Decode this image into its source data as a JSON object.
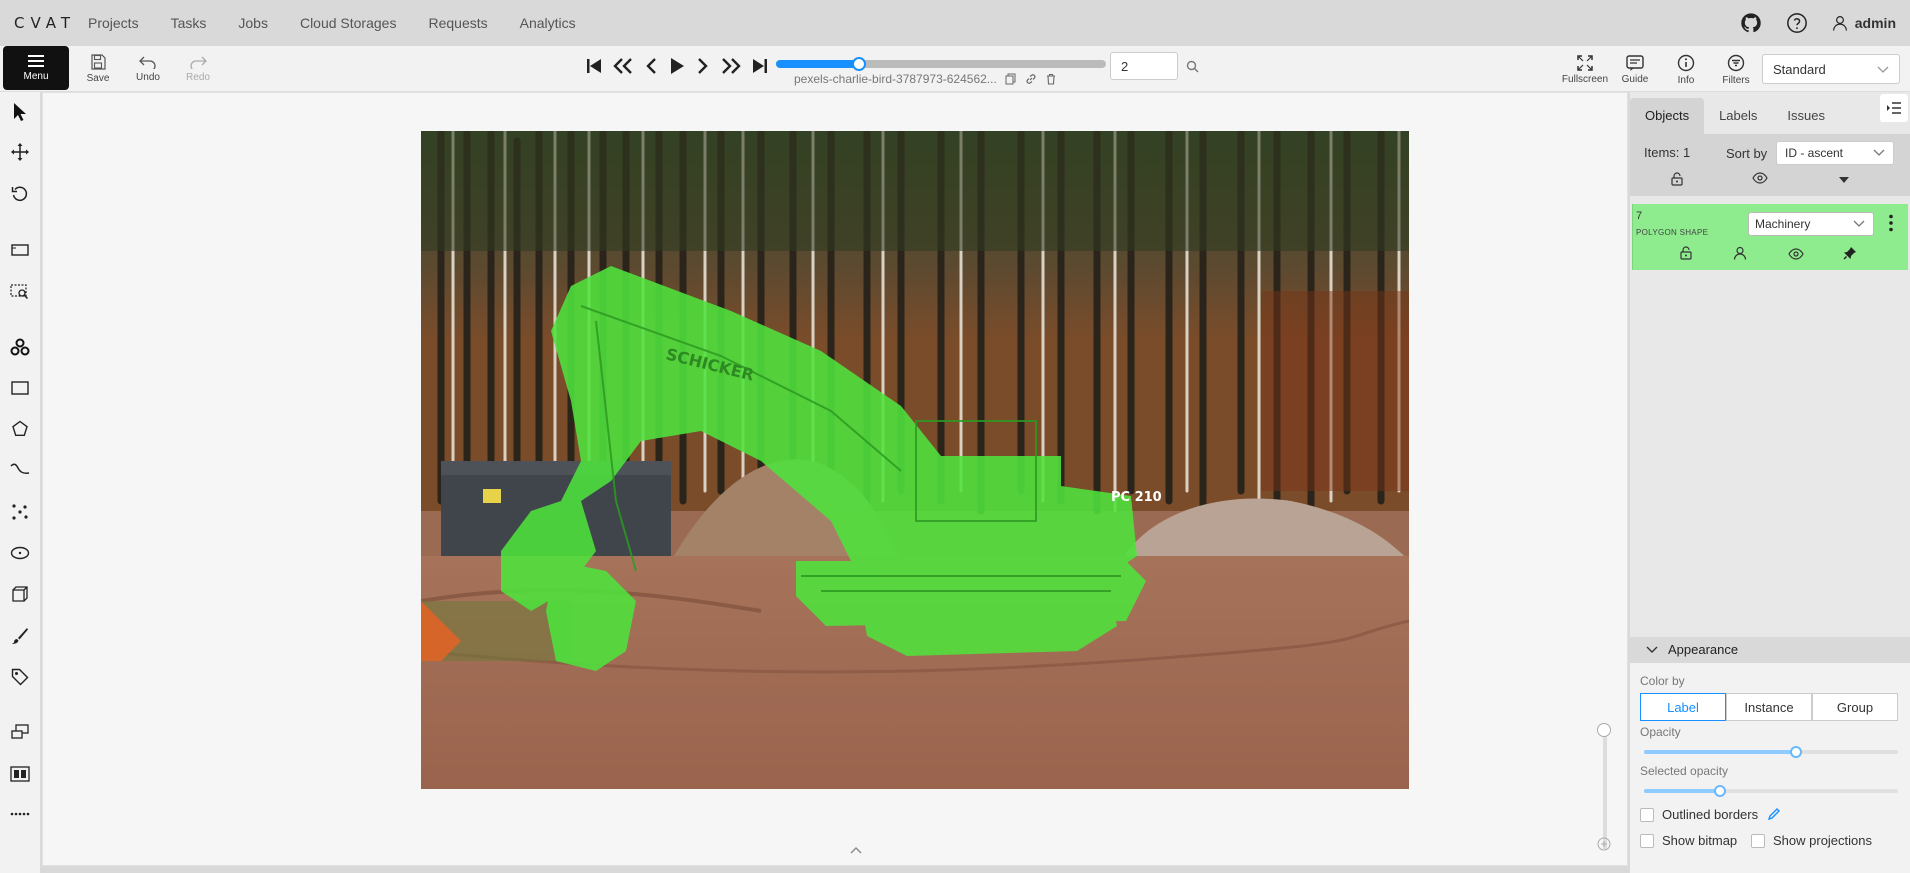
{
  "topnav": {
    "logo": "CVAT",
    "links": [
      "Projects",
      "Tasks",
      "Jobs",
      "Cloud Storages",
      "Requests",
      "Analytics"
    ],
    "user": "admin"
  },
  "toolbar": {
    "menu_label": "Menu",
    "save_label": "Save",
    "undo_label": "Undo",
    "redo_label": "Redo",
    "filename": "pexels-charlie-bird-3787973-624562...",
    "frame_number": "2",
    "frame_progress": 0.25,
    "fullscreen_label": "Fullscreen",
    "guide_label": "Guide",
    "info_label": "Info",
    "filters_label": "Filters",
    "workspace": "Standard"
  },
  "sidebar": {
    "tabs": [
      "Objects",
      "Labels",
      "Issues"
    ],
    "active_tab": "Objects",
    "items_count": "Items: 1",
    "sort_by_label": "Sort by",
    "sort_value": "ID - ascent",
    "objects": [
      {
        "id": "7",
        "type": "POLYGON SHAPE",
        "label": "Machinery",
        "color": "#8eec8e"
      }
    ]
  },
  "appearance": {
    "title": "Appearance",
    "color_by_label": "Color by",
    "color_by_options": [
      "Label",
      "Instance",
      "Group"
    ],
    "color_by_selected": "Label",
    "opacity_label": "Opacity",
    "opacity_value": 0.6,
    "selected_opacity_label": "Selected opacity",
    "selected_opacity_value": 0.3,
    "outlined_borders_label": "Outlined borders",
    "show_bitmap_label": "Show bitmap",
    "show_projections_label": "Show projections"
  },
  "canvas": {
    "overlay_color": "#4ee33c",
    "machine_text": "SCHICKER",
    "model_text": "PC 210"
  }
}
